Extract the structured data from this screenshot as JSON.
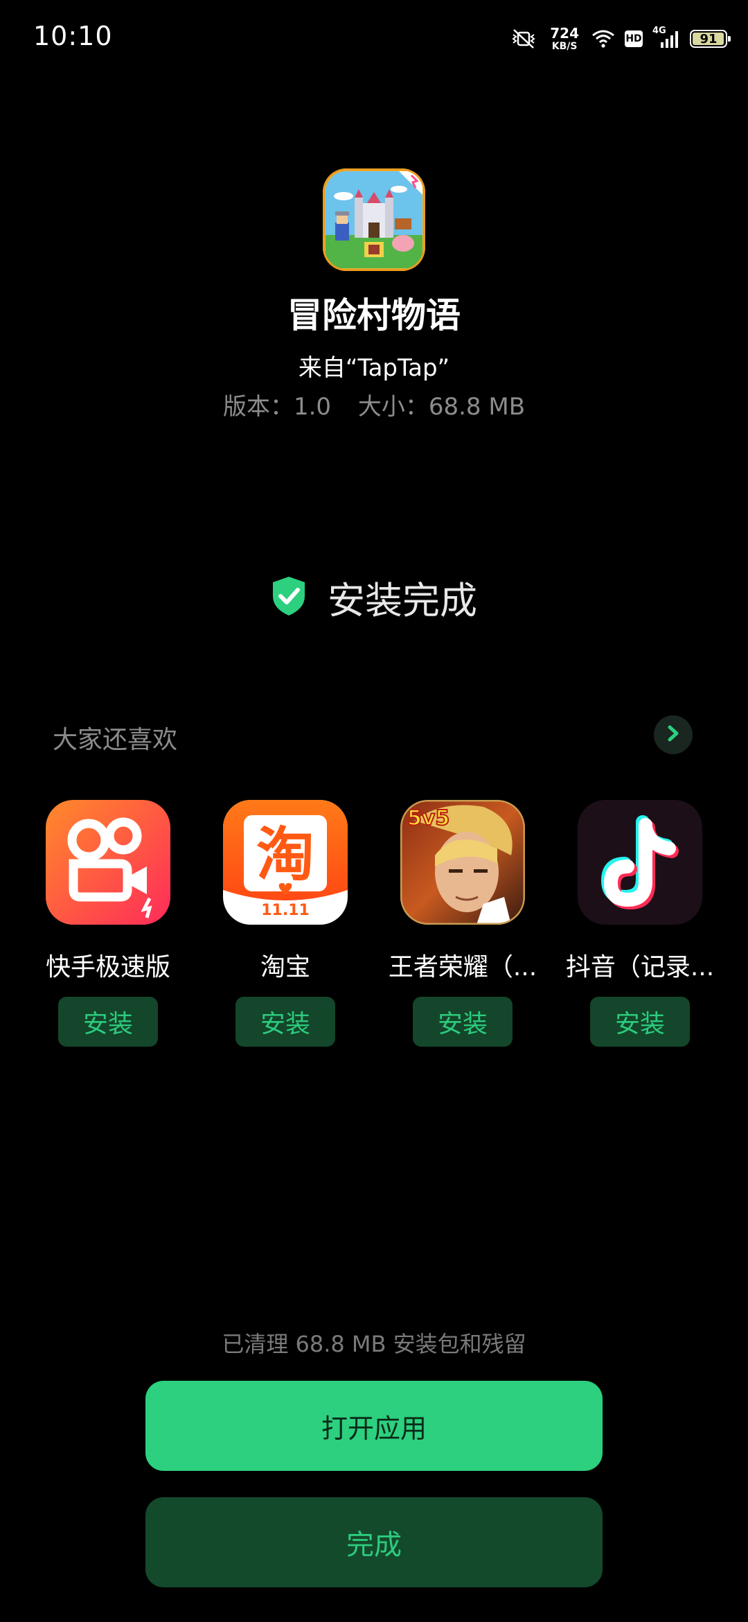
{
  "status_bar": {
    "time": "10:10",
    "net_speed_value": "724",
    "net_speed_unit": "KB/S",
    "hd_label": "HD",
    "network_type": "4G",
    "battery_level": "91",
    "icons": [
      "mute-vibrate-icon",
      "wifi-icon",
      "hd-icon",
      "signal-icon",
      "battery-icon"
    ]
  },
  "app": {
    "icon": "adventure-village-game-icon",
    "name": "冒险村物语",
    "source": "来自“TapTap”",
    "version_text": "版本：1.0",
    "size_text": "大小：68.8 MB"
  },
  "install": {
    "status_text": "安装完成",
    "status_icon": "shield-check-icon",
    "accent_color": "#2cd07f"
  },
  "recommendations": {
    "title": "大家还喜欢",
    "more_icon": "chevron-right-icon",
    "items": [
      {
        "name": "快手极速版",
        "icon": "kuaishou-lite-icon",
        "install_label": "安装"
      },
      {
        "name": "淘宝",
        "icon": "taobao-icon",
        "install_label": "安装"
      },
      {
        "name": "王者荣耀（...",
        "icon": "honor-of-kings-icon",
        "install_label": "安装"
      },
      {
        "name": "抖音（记录...",
        "icon": "douyin-icon",
        "install_label": "安装"
      }
    ]
  },
  "footer": {
    "cleanup_text": "已清理 68.8 MB 安装包和残留",
    "open_button": "打开应用",
    "done_button": "完成"
  }
}
